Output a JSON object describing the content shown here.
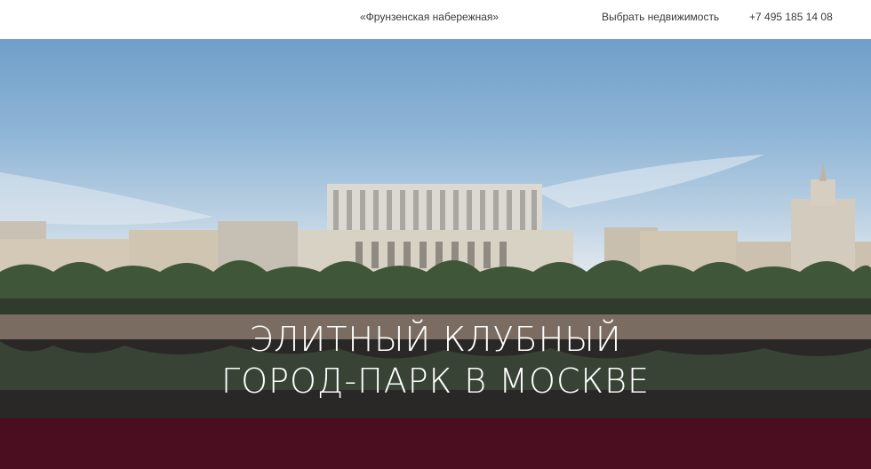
{
  "header": {
    "project_link": "«Фрунзенская набережная»",
    "select_property": "Выбрать недвижимость",
    "phone": "+7 495 185 14 08"
  },
  "hero": {
    "title_line1": "ЭЛИТНЫЙ КЛУБНЫЙ",
    "title_line2": "ГОРОД-ПАРК В МОСКВЕ"
  },
  "colors": {
    "bottom_band": "#4a0e20",
    "header_bg": "#ffffff"
  }
}
